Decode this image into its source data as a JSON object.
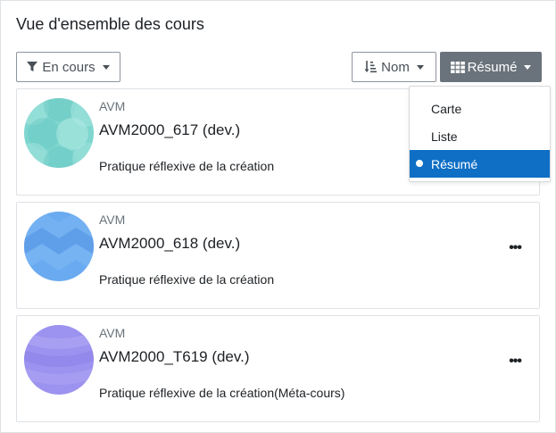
{
  "block": {
    "title": "Vue d'ensemble des cours"
  },
  "toolbar": {
    "filter_label": "En cours",
    "sort_label": "Nom",
    "view_label": "Résumé"
  },
  "view_menu": {
    "items": [
      {
        "label": "Carte",
        "active": false
      },
      {
        "label": "Liste",
        "active": false
      },
      {
        "label": "Résumé",
        "active": true
      }
    ]
  },
  "courses": [
    {
      "category": "AVM",
      "name": "AVM2000_617 (dev.)",
      "summary": "Pratique réflexive de la création",
      "image_color": "#7ed6cf"
    },
    {
      "category": "AVM",
      "name": "AVM2000_618 (dev.)",
      "summary": "Pratique réflexive de la création",
      "image_color": "#6aaaf0"
    },
    {
      "category": "AVM",
      "name": "AVM2000_T619 (dev.)",
      "summary": "Pratique réflexive de la création(Méta-cours)",
      "image_color": "#9c92ef"
    }
  ],
  "icons": {
    "filter": "filter-icon",
    "sort": "sort-alpha-icon",
    "view": "grid-icon",
    "course_menu": "ellipsis-icon"
  }
}
